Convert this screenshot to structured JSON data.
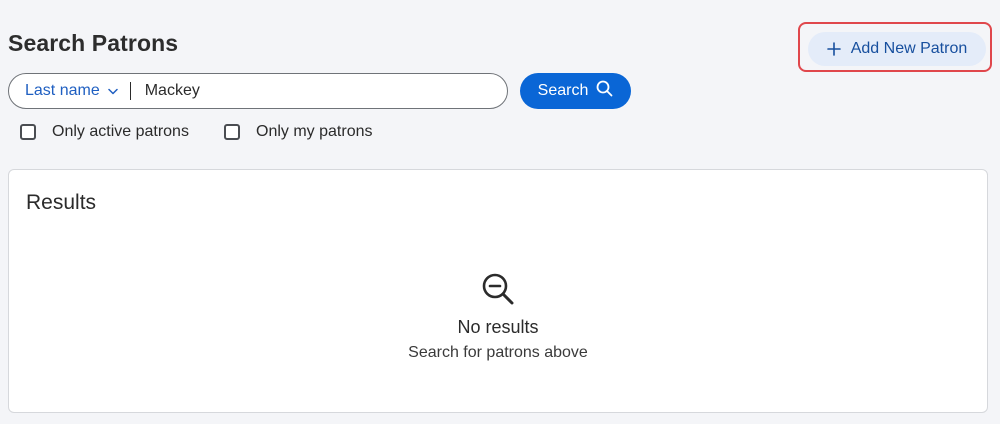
{
  "header": {
    "title": "Search Patrons",
    "add_button_label": "Add New Patron"
  },
  "search": {
    "field_selected": "Last name",
    "query_value": "Mackey",
    "button_label": "Search"
  },
  "filters": [
    {
      "label": "Only active patrons",
      "checked": false
    },
    {
      "label": "Only my patrons",
      "checked": false
    }
  ],
  "results": {
    "title": "Results",
    "empty_title": "No results",
    "empty_subtitle": "Search for patrons above"
  },
  "icons": {
    "add": "plus-icon",
    "field_dropdown": "chevron-down-icon",
    "search": "search-icon",
    "empty": "zoom-out-icon"
  },
  "colors": {
    "accent": "#0a66d6",
    "link": "#1f5fc1",
    "highlight_border": "#e0474c",
    "secondary_button_bg": "#e4ecf9"
  }
}
